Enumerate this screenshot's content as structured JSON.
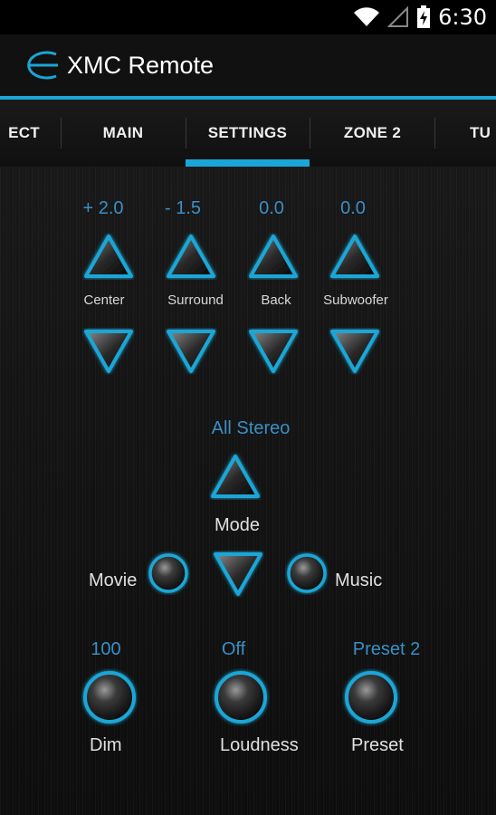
{
  "status": {
    "time": "6:30"
  },
  "app": {
    "title": "XMC Remote"
  },
  "tabs": [
    "ECT",
    "MAIN",
    "SETTINGS",
    "ZONE 2",
    "TU"
  ],
  "levels": [
    {
      "value": "+ 2.0",
      "label": "Center"
    },
    {
      "value": "- 1.5",
      "label": "Surround"
    },
    {
      "value": "0.0",
      "label": "Back"
    },
    {
      "value": "0.0",
      "label": "Subwoofer"
    }
  ],
  "mode": {
    "value": "All Stereo",
    "label": "Mode",
    "movie_label": "Movie",
    "music_label": "Music"
  },
  "bottom": [
    {
      "value": "100",
      "label": "Dim"
    },
    {
      "value": "Off",
      "label": "Loudness"
    },
    {
      "value": "Preset 2",
      "label": "Preset"
    }
  ],
  "colors": {
    "accent": "#1aa6d6",
    "value_text": "#3a8fc4"
  }
}
